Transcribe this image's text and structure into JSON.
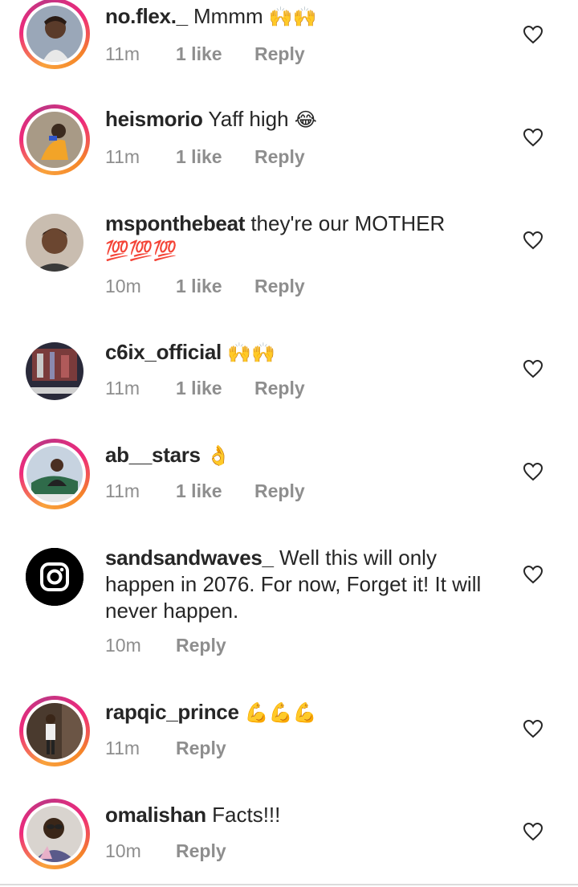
{
  "comments": [
    {
      "username": "no.flex._",
      "text": "Mmmm",
      "emoji": "🙌🙌",
      "time": "11m",
      "likes": "1 like",
      "reply": "Reply"
    },
    {
      "username": "heismorio",
      "text": "Yaff high",
      "emoji": "😂",
      "time": "11m",
      "likes": "1 like",
      "reply": "Reply"
    },
    {
      "username": "msponthebeat",
      "text": "they're our MOTHER",
      "emoji": "💯💯💯",
      "time": "10m",
      "likes": "1 like",
      "reply": "Reply"
    },
    {
      "username": "c6ix_official",
      "text": "",
      "emoji": "🙌🙌",
      "time": "11m",
      "likes": "1 like",
      "reply": "Reply"
    },
    {
      "username": "ab__stars",
      "text": "",
      "emoji": "👌",
      "time": "11m",
      "likes": "1 like",
      "reply": "Reply"
    },
    {
      "username": "sandsandwaves_",
      "text": "Well this will only happen in 2076. For now, Forget it! It will never happen.",
      "emoji": "",
      "time": "10m",
      "likes": "",
      "reply": "Reply"
    },
    {
      "username": "rapqic_prince",
      "text": "",
      "emoji": "💪💪💪",
      "time": "11m",
      "likes": "",
      "reply": "Reply"
    },
    {
      "username": "omalishan",
      "text": "Facts!!!",
      "emoji": "",
      "time": "10m",
      "likes": "",
      "reply": "Reply"
    }
  ],
  "colors": {
    "text": "#262626",
    "meta": "#8e8e8e",
    "story_ring_start": "#f9a23c",
    "story_ring_end": "#c13584"
  }
}
